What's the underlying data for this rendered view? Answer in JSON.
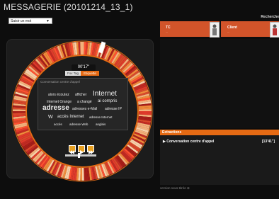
{
  "header": {
    "title": "MESSAGERIE (20101214_13_1)",
    "search_label": "Recherche"
  },
  "select_word": {
    "label": "Saisir un mot"
  },
  "speakers": [
    {
      "label": "TC",
      "sub": "..."
    },
    {
      "label": "Client",
      "sub": "..."
    }
  ],
  "player": {
    "time": "00'17\"",
    "tab_a": "Fox Tag",
    "tab_b": "Etiquette",
    "cloud_title": "Conversation centre d'appel",
    "volume": 0.45
  },
  "cloud_words": [
    "alors écoutez",
    "afficher",
    "Internet",
    "Internet Orange",
    "a changé",
    "ai compris",
    "adresse",
    "adresses e-Mail",
    "adresse IP",
    "W",
    "accès Internet",
    "adresse Internet",
    "accés",
    "adresse Web",
    "anglais"
  ],
  "section": {
    "title": "Extractions"
  },
  "conversation": {
    "item": "Conversation centre d'appel",
    "duration": "[13'41\"]"
  },
  "bottom": {
    "link": "version sous-titrée ⊕"
  },
  "colors": {
    "accent": "#e56a14",
    "speaker_bar": "#d2542a"
  }
}
